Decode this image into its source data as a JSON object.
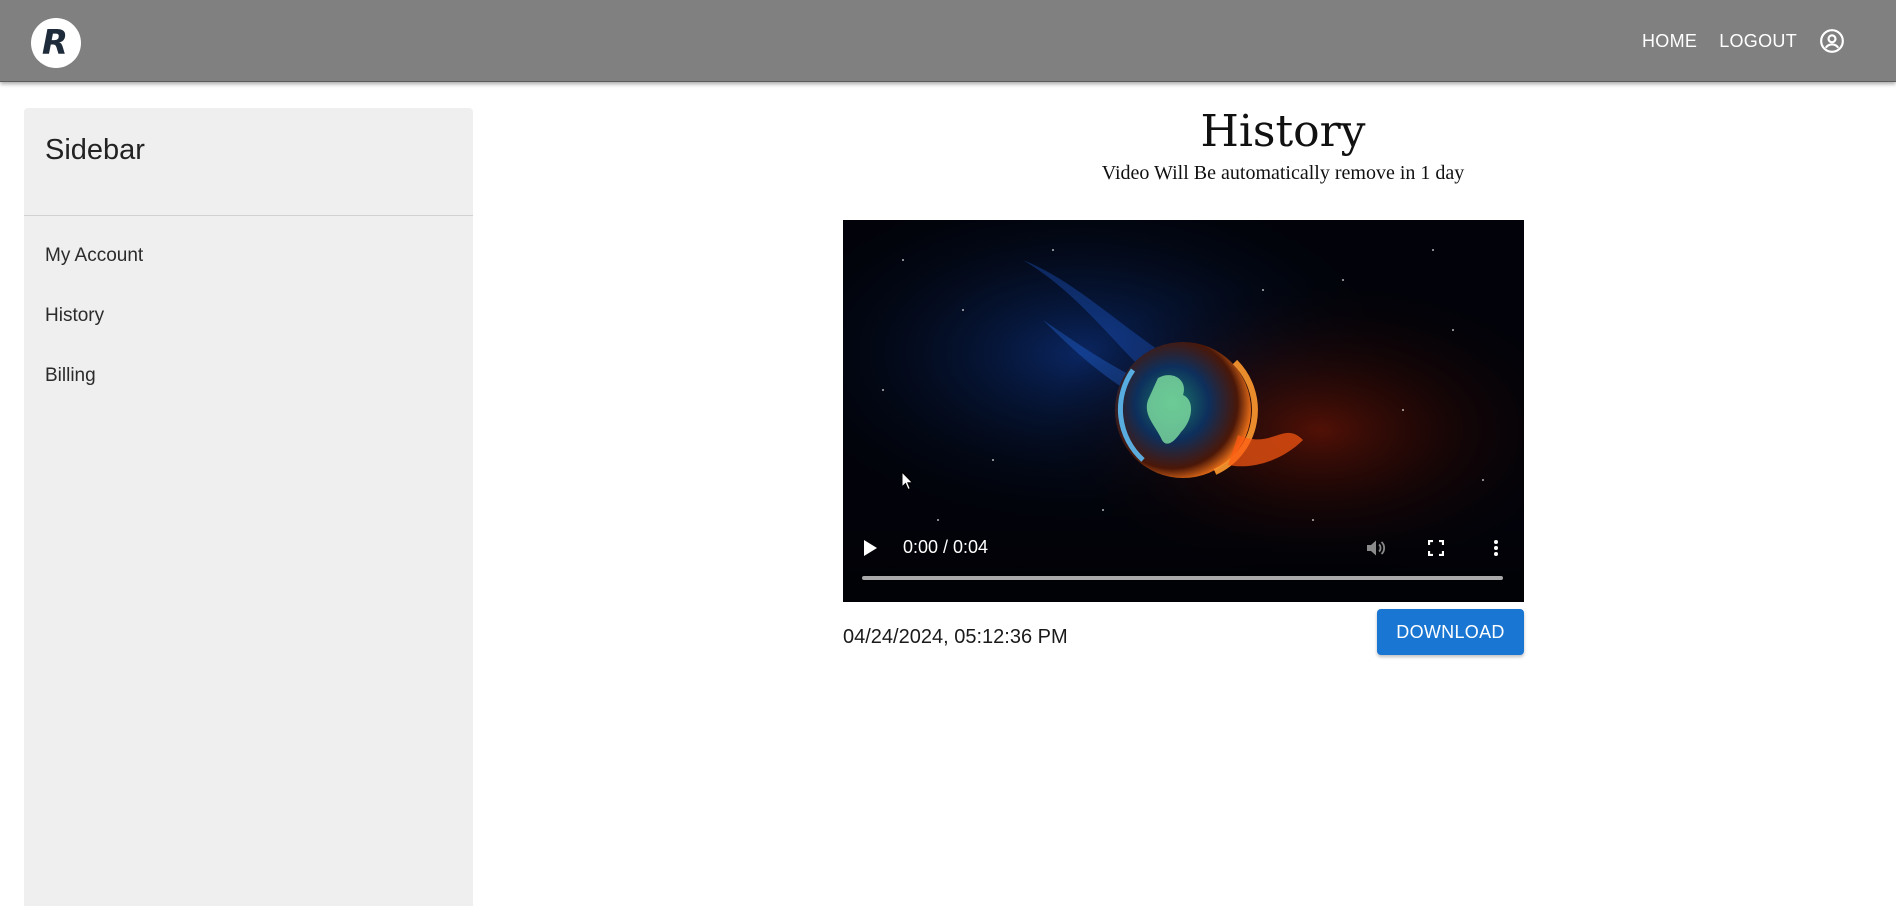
{
  "header": {
    "logo_letter": "R",
    "nav": {
      "home": "HOME",
      "logout": "LOGOUT"
    },
    "account_icon": "account-circle-icon",
    "background": "#808080"
  },
  "sidebar": {
    "title": "Sidebar",
    "items": [
      {
        "label": "My Account"
      },
      {
        "label": "History"
      },
      {
        "label": "Billing"
      }
    ]
  },
  "main": {
    "title": "History",
    "subtitle": "Video Will Be automatically remove in 1 day",
    "videos": [
      {
        "time_display": "0:00 / 0:04",
        "progress": 0,
        "timestamp": "04/24/2024, 05:12:36 PM",
        "download_label": "DOWNLOAD",
        "icons": [
          "play-icon",
          "volume-icon",
          "fullscreen-icon",
          "more-vert-icon"
        ]
      }
    ]
  },
  "colors": {
    "accent": "#1976d2",
    "sidebar_bg": "#efefef"
  }
}
